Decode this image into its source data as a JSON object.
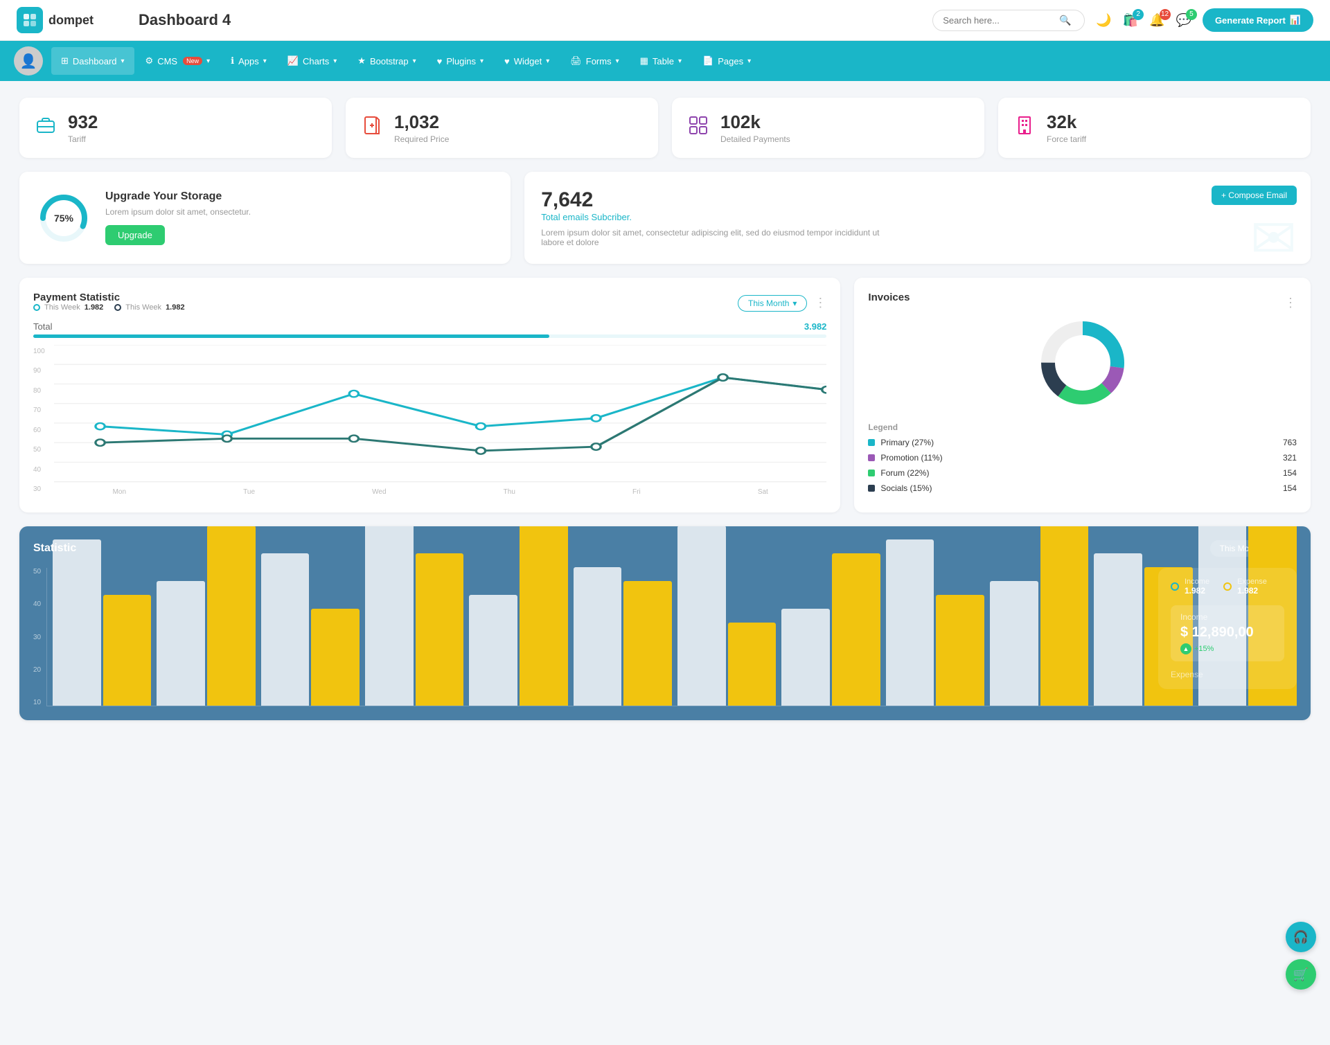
{
  "app": {
    "logo_text": "dompet",
    "page_title": "Dashboard 4",
    "search_placeholder": "Search here...",
    "generate_report_label": "Generate Report"
  },
  "topbar_icons": {
    "compare_badge": "2",
    "bell_badge": "12",
    "chat_badge": "5"
  },
  "navbar": {
    "items": [
      {
        "id": "dashboard",
        "label": "Dashboard",
        "active": true,
        "has_chevron": true,
        "icon": "grid"
      },
      {
        "id": "cms",
        "label": "CMS",
        "active": false,
        "has_chevron": true,
        "icon": "gear",
        "badge": "New"
      },
      {
        "id": "apps",
        "label": "Apps",
        "active": false,
        "has_chevron": true,
        "icon": "info"
      },
      {
        "id": "charts",
        "label": "Charts",
        "active": false,
        "has_chevron": true,
        "icon": "chart"
      },
      {
        "id": "bootstrap",
        "label": "Bootstrap",
        "active": false,
        "has_chevron": true,
        "icon": "star"
      },
      {
        "id": "plugins",
        "label": "Plugins",
        "active": false,
        "has_chevron": true,
        "icon": "heart"
      },
      {
        "id": "widget",
        "label": "Widget",
        "active": false,
        "has_chevron": true,
        "icon": "heart2"
      },
      {
        "id": "forms",
        "label": "Forms",
        "active": false,
        "has_chevron": true,
        "icon": "print"
      },
      {
        "id": "table",
        "label": "Table",
        "active": false,
        "has_chevron": true,
        "icon": "table"
      },
      {
        "id": "pages",
        "label": "Pages",
        "active": false,
        "has_chevron": true,
        "icon": "pages"
      }
    ]
  },
  "stat_cards": [
    {
      "value": "932",
      "label": "Tariff",
      "icon": "briefcase",
      "color": "teal"
    },
    {
      "value": "1,032",
      "label": "Required Price",
      "icon": "file-plus",
      "color": "red"
    },
    {
      "value": "102k",
      "label": "Detailed Payments",
      "icon": "grid2",
      "color": "purple"
    },
    {
      "value": "32k",
      "label": "Force tariff",
      "icon": "building",
      "color": "pink"
    }
  ],
  "upgrade": {
    "percent": 75,
    "percent_label": "75%",
    "title": "Upgrade Your Storage",
    "description": "Lorem ipsum dolor sit amet, onsectetur.",
    "button_label": "Upgrade"
  },
  "email_card": {
    "number": "7,642",
    "subtitle": "Total emails Subcriber.",
    "description": "Lorem ipsum dolor sit amet, consectetur adipiscing elit, sed do eiusmod tempor incididunt ut labore et dolore",
    "compose_label": "+ Compose Email"
  },
  "payment_statistic": {
    "title": "Payment Statistic",
    "filter_label": "This Month",
    "legend": [
      {
        "label": "This Week",
        "value": "1.982",
        "color": "teal"
      },
      {
        "label": "This Week",
        "value": "1.982",
        "color": "dark"
      }
    ],
    "total_label": "Total",
    "total_value": "3.982",
    "x_labels": [
      "Mon",
      "Tue",
      "Wed",
      "Thu",
      "Fri",
      "Sat"
    ],
    "y_labels": [
      "100",
      "90",
      "80",
      "70",
      "60",
      "50",
      "40",
      "30"
    ],
    "line1_points": "60,40 130,50 215,30 300,40 370,60 460,65 545,25 630,30",
    "line2_points": "60,60 130,55 215,55 300,70 370,65 460,55 545,25 630,30"
  },
  "invoices": {
    "title": "Invoices",
    "donut_data": [
      {
        "label": "Primary",
        "percent": 27,
        "value": "763",
        "color": "#1ab6c8"
      },
      {
        "label": "Promotion",
        "percent": 11,
        "value": "321",
        "color": "#9b59b6"
      },
      {
        "label": "Forum",
        "percent": 22,
        "value": "154",
        "color": "#2ecc71"
      },
      {
        "label": "Socials",
        "percent": 15,
        "value": "154",
        "color": "#2c3e50"
      }
    ]
  },
  "statistic": {
    "title": "Statistic",
    "filter_label": "This Month",
    "income_label": "Income",
    "income_value": "1.982",
    "expense_label": "Expense",
    "expense_value": "1.982",
    "income_box_title": "Income",
    "income_amount": "$ 12,890,00",
    "income_change": "+15%",
    "y_labels": [
      "50",
      "40",
      "30",
      "20",
      "10"
    ],
    "bar_groups": [
      {
        "white": 60,
        "yellow": 40
      },
      {
        "white": 45,
        "yellow": 65
      },
      {
        "white": 55,
        "yellow": 35
      },
      {
        "white": 70,
        "yellow": 55
      },
      {
        "white": 40,
        "yellow": 75
      },
      {
        "white": 50,
        "yellow": 45
      },
      {
        "white": 65,
        "yellow": 30
      },
      {
        "white": 35,
        "yellow": 55
      },
      {
        "white": 60,
        "yellow": 40
      },
      {
        "white": 45,
        "yellow": 70
      },
      {
        "white": 55,
        "yellow": 50
      },
      {
        "white": 70,
        "yellow": 85
      }
    ]
  }
}
